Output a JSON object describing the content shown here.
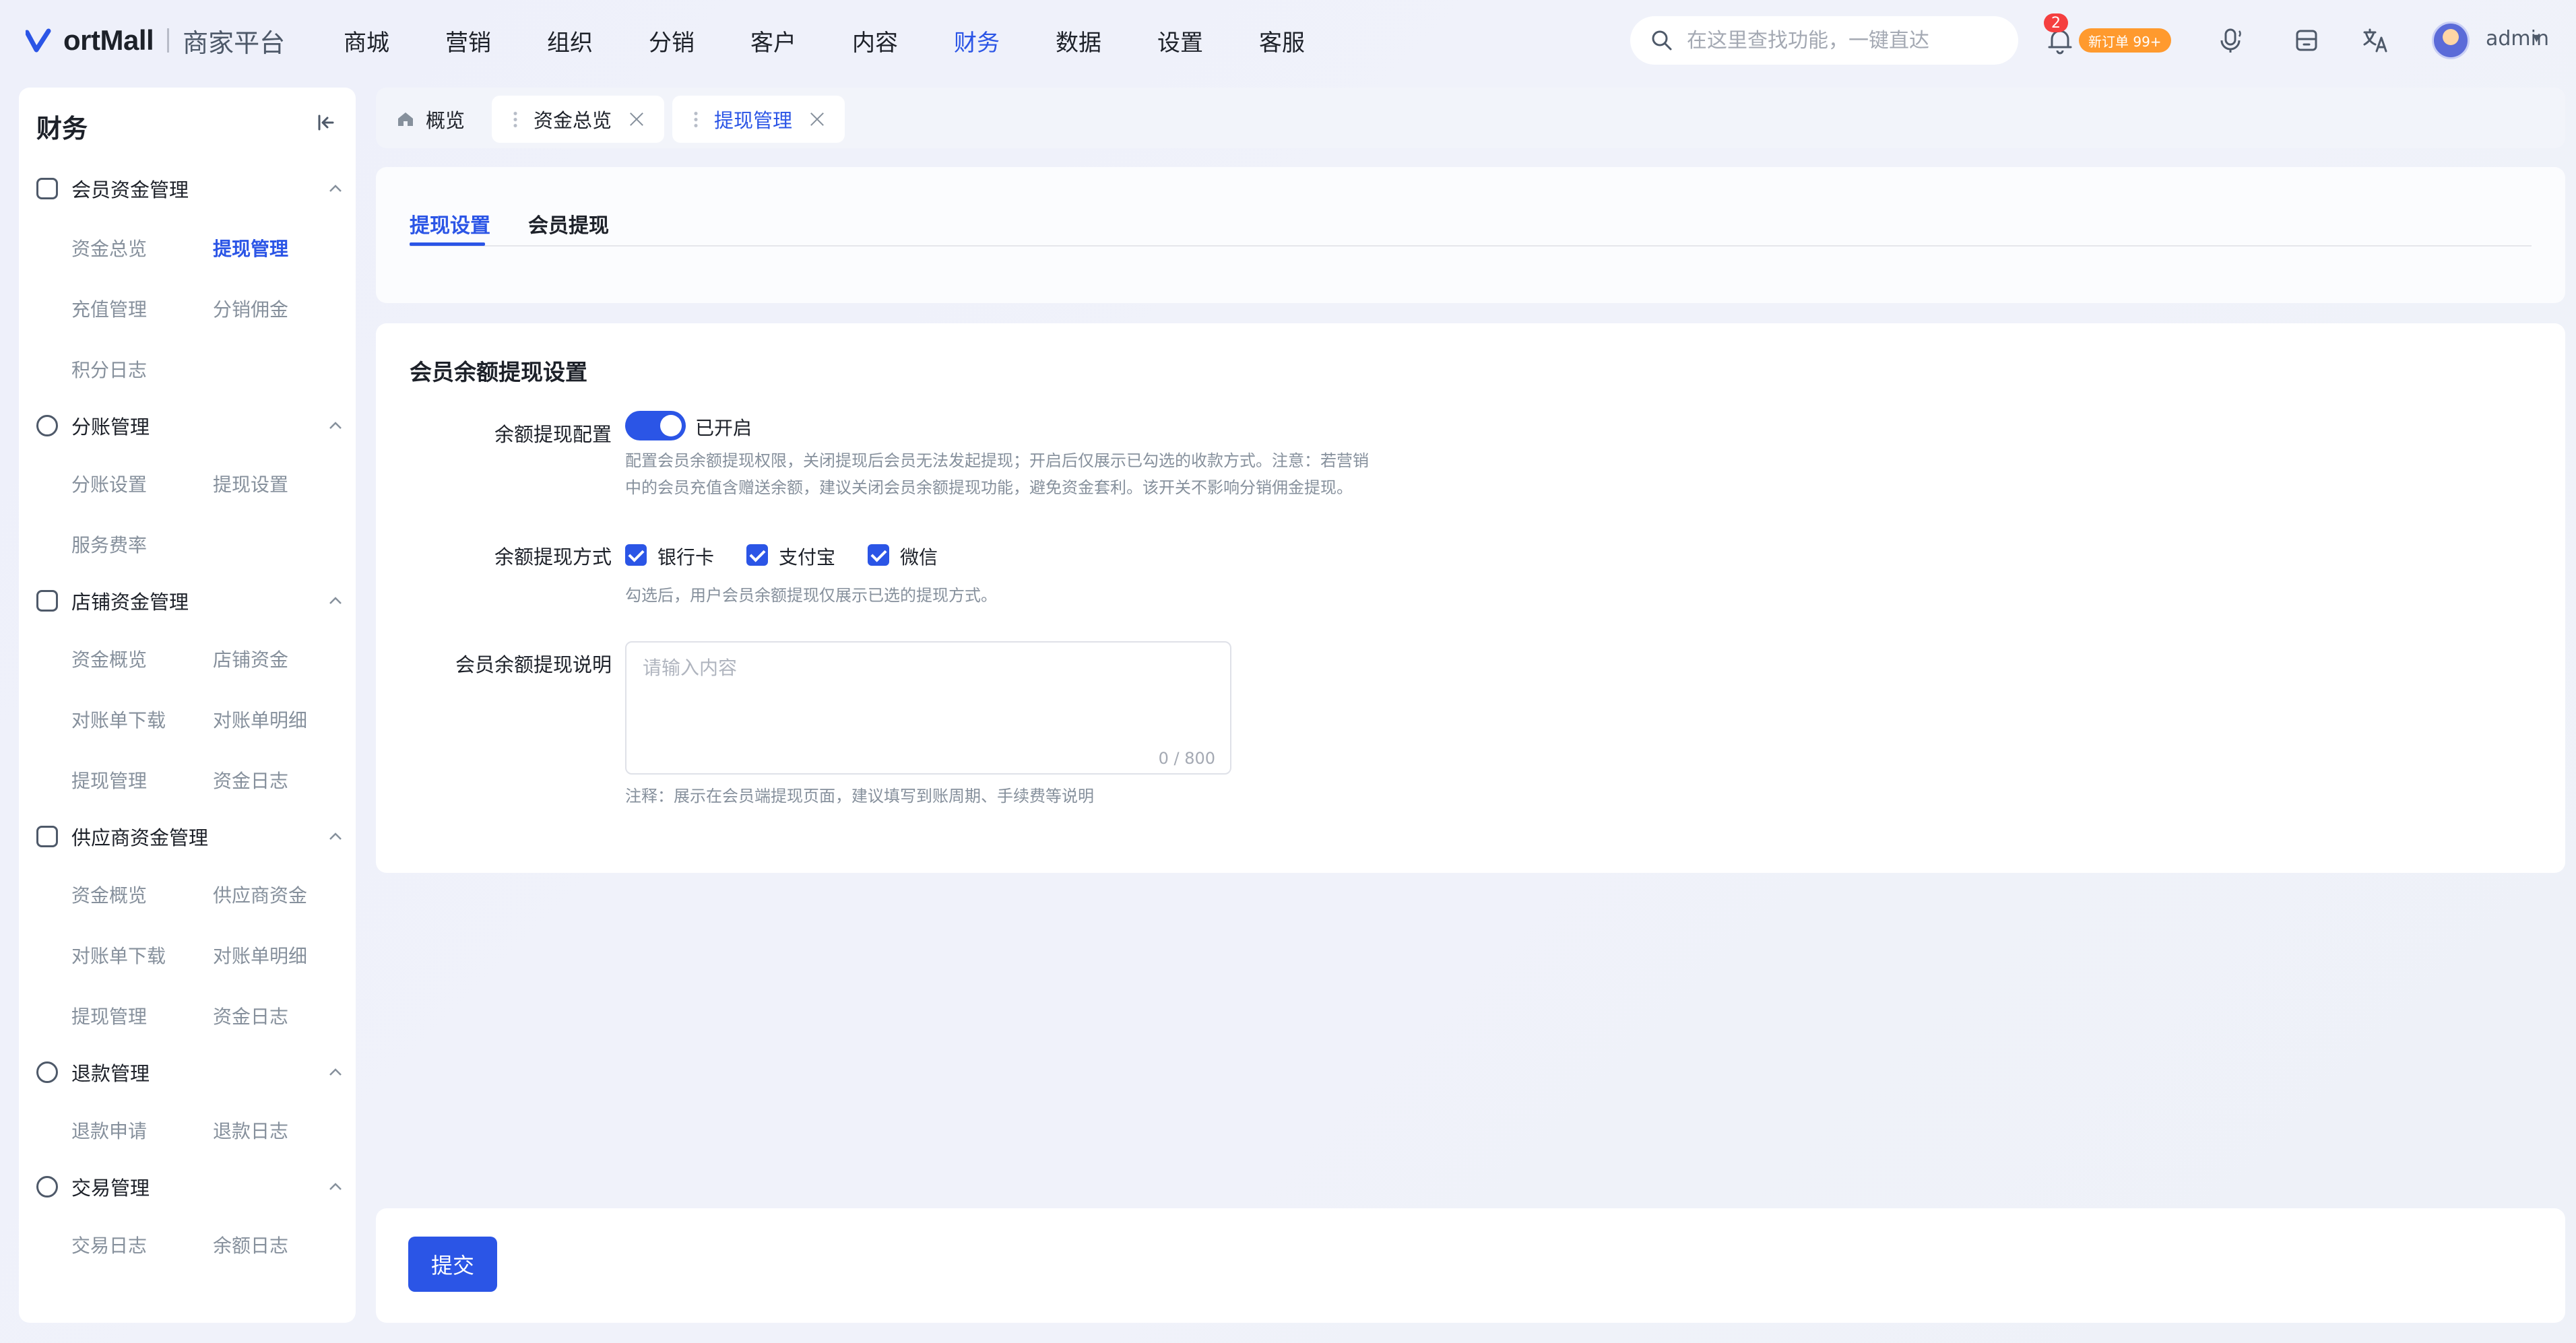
{
  "app": {
    "brand": "ortMall",
    "subtitle": "商家平台"
  },
  "topnav": [
    "商城",
    "营销",
    "组织",
    "分销",
    "客户",
    "内容",
    "财务",
    "数据",
    "设置",
    "客服"
  ],
  "topnav_active": "财务",
  "search": {
    "placeholder": "在这里查找功能，一键直达"
  },
  "header": {
    "bell_badge": "2",
    "order_pill": "新订单 99+",
    "username": "admin"
  },
  "sidebar": {
    "title": "财务",
    "groups": [
      {
        "label": "会员资金管理",
        "items": [
          "资金总览",
          "提现管理",
          "充值管理",
          "分销佣金",
          "积分日志"
        ]
      },
      {
        "label": "分账管理",
        "items": [
          "分账设置",
          "提现设置",
          "服务费率"
        ]
      },
      {
        "label": "店铺资金管理",
        "items": [
          "资金概览",
          "店铺资金",
          "对账单下载",
          "对账单明细",
          "提现管理",
          "资金日志"
        ]
      },
      {
        "label": "供应商资金管理",
        "items": [
          "资金概览",
          "供应商资金",
          "对账单下载",
          "对账单明细",
          "提现管理",
          "资金日志"
        ]
      },
      {
        "label": "退款管理",
        "items": [
          "退款申请",
          "退款日志"
        ]
      },
      {
        "label": "交易管理",
        "items": [
          "交易日志",
          "余额日志"
        ]
      }
    ]
  },
  "page_tabs": [
    "概览",
    "资金总览",
    "提现管理"
  ],
  "sub_tabs": [
    "提现设置",
    "会员提现"
  ],
  "form": {
    "title": "会员余额提现设置",
    "toggle": {
      "label": "余额提现配置",
      "state_text": "已开启",
      "enabled": true,
      "hint_line1": "配置会员余额提现权限，关闭提现后会员无法发起提现；开启后仅展示已勾选的收款方式。注意：若营销",
      "hint_line2": "中的会员充值含赠送余额，建议关闭会员余额提现功能，避免资金套利。该开关不影响分销佣金提现。"
    },
    "methods": {
      "label": "余额提现方式",
      "options": [
        "银行卡",
        "支付宝",
        "微信"
      ],
      "hint": "勾选后，用户会员余额提现仅展示已选的提现方式。"
    },
    "description": {
      "label": "会员余额提现说明",
      "placeholder": "请输入内容",
      "count": "0 / 800",
      "note": "注释：展示在会员端提现页面，建议填写到账周期、手续费等说明"
    }
  },
  "footer": {
    "submit": "提交"
  },
  "colors": {
    "primary": "#2b55e6",
    "badge": "#f53f3f",
    "order": "#ff9a2e"
  }
}
